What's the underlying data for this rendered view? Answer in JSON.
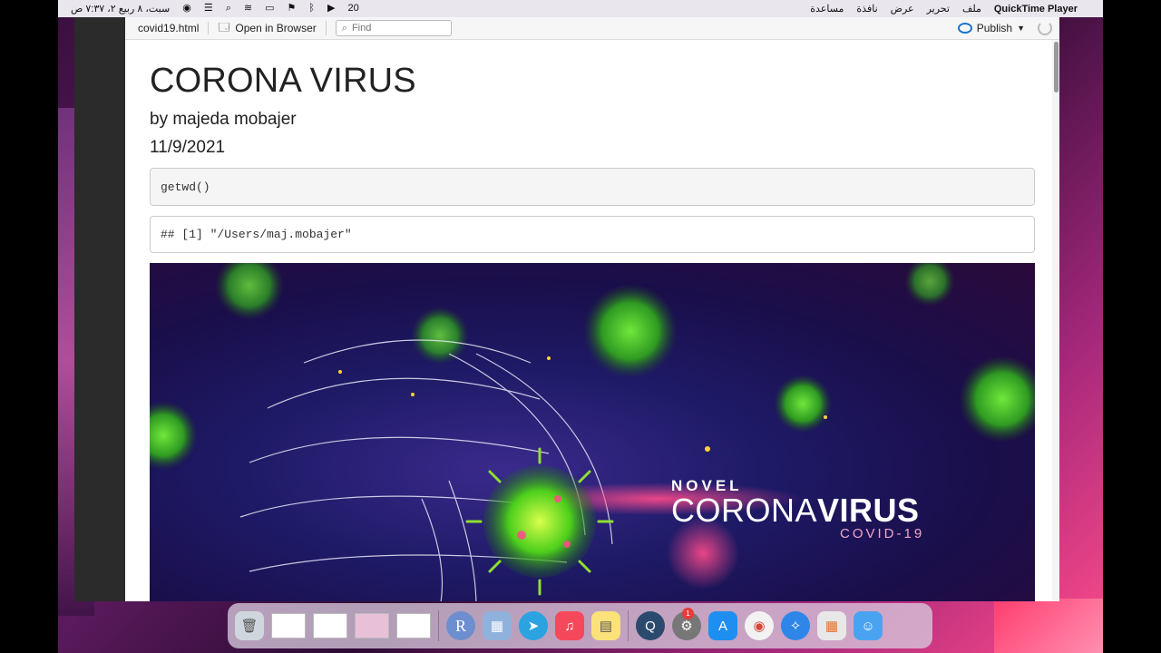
{
  "menubar": {
    "app_name": "QuickTime Player",
    "menus": [
      "ملف",
      "تحرير",
      "عرض",
      "نافذة",
      "مساعدة"
    ],
    "clock": "سبت، ٨ ربيع ٢، ٧:٣٧ ص",
    "notification_count": "20"
  },
  "toolbar": {
    "filename": "covid19.html",
    "open_in_browser": "Open in Browser",
    "find_placeholder": "Find",
    "publish_label": "Publish"
  },
  "document": {
    "title": "CORONA VIRUS",
    "author": "by majeda mobajer",
    "date": "11/9/2021",
    "code": "getwd()",
    "output": "## [1] \"/Users/maj.mobajer\""
  },
  "banner": {
    "line1": "NOVEL",
    "line2a": "CORONA",
    "line2b": "VIRUS",
    "line3": "COVID-19"
  },
  "dock": {
    "r_label": "R",
    "badge_count": "1",
    "items": [
      "trash",
      "finder-window",
      "chrome-window",
      "screenshot",
      "music-window",
      "r-app",
      "preview",
      "telegram",
      "music",
      "notes",
      "quicktime",
      "system-preferences",
      "app-store",
      "chrome",
      "safari",
      "launchpad",
      "finder"
    ]
  }
}
